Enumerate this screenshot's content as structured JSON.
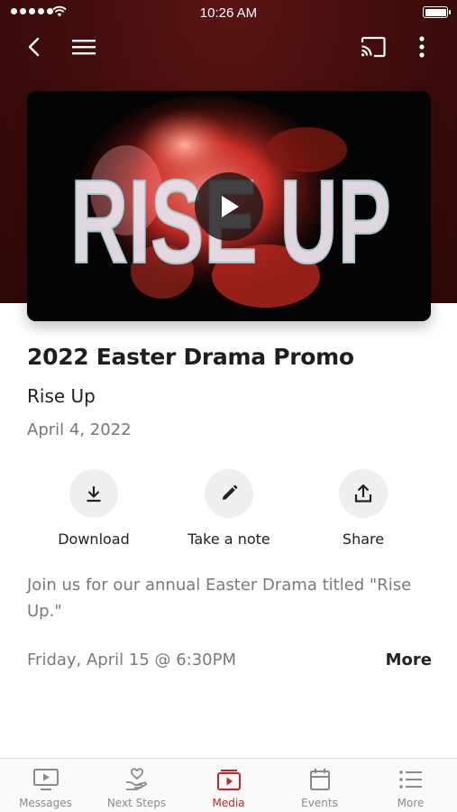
{
  "status_bar": {
    "time": "10:26 AM"
  },
  "top_nav": {
    "icons": [
      "back-icon",
      "menu-icon",
      "cast-icon",
      "more-vertical-icon"
    ]
  },
  "video": {
    "overlay_text": "RISE UP",
    "play_icon": "play-icon"
  },
  "content": {
    "title": "2022 Easter Drama Promo",
    "series": "Rise Up",
    "date": "April 4, 2022",
    "description": "Join us for our annual Easter Drama titled \"Rise Up.\"",
    "event_date": "Friday, April 15 @ 6:30PM",
    "more_label": "More"
  },
  "actions": [
    {
      "label": "Download",
      "icon": "download-icon"
    },
    {
      "label": "Take a note",
      "icon": "pencil-icon"
    },
    {
      "label": "Share",
      "icon": "share-icon"
    }
  ],
  "tabs": [
    {
      "label": "Messages",
      "icon": "tv-play-icon",
      "active": false
    },
    {
      "label": "Next Steps",
      "icon": "heart-hand-icon",
      "active": false
    },
    {
      "label": "Media",
      "icon": "media-icon",
      "active": true
    },
    {
      "label": "Events",
      "icon": "calendar-icon",
      "active": false
    },
    {
      "label": "More",
      "icon": "list-icon",
      "active": false
    }
  ],
  "colors": {
    "accent": "#c8202b",
    "hero_background": "#4a0f0f",
    "inactive_tab": "#8a8a8a"
  }
}
